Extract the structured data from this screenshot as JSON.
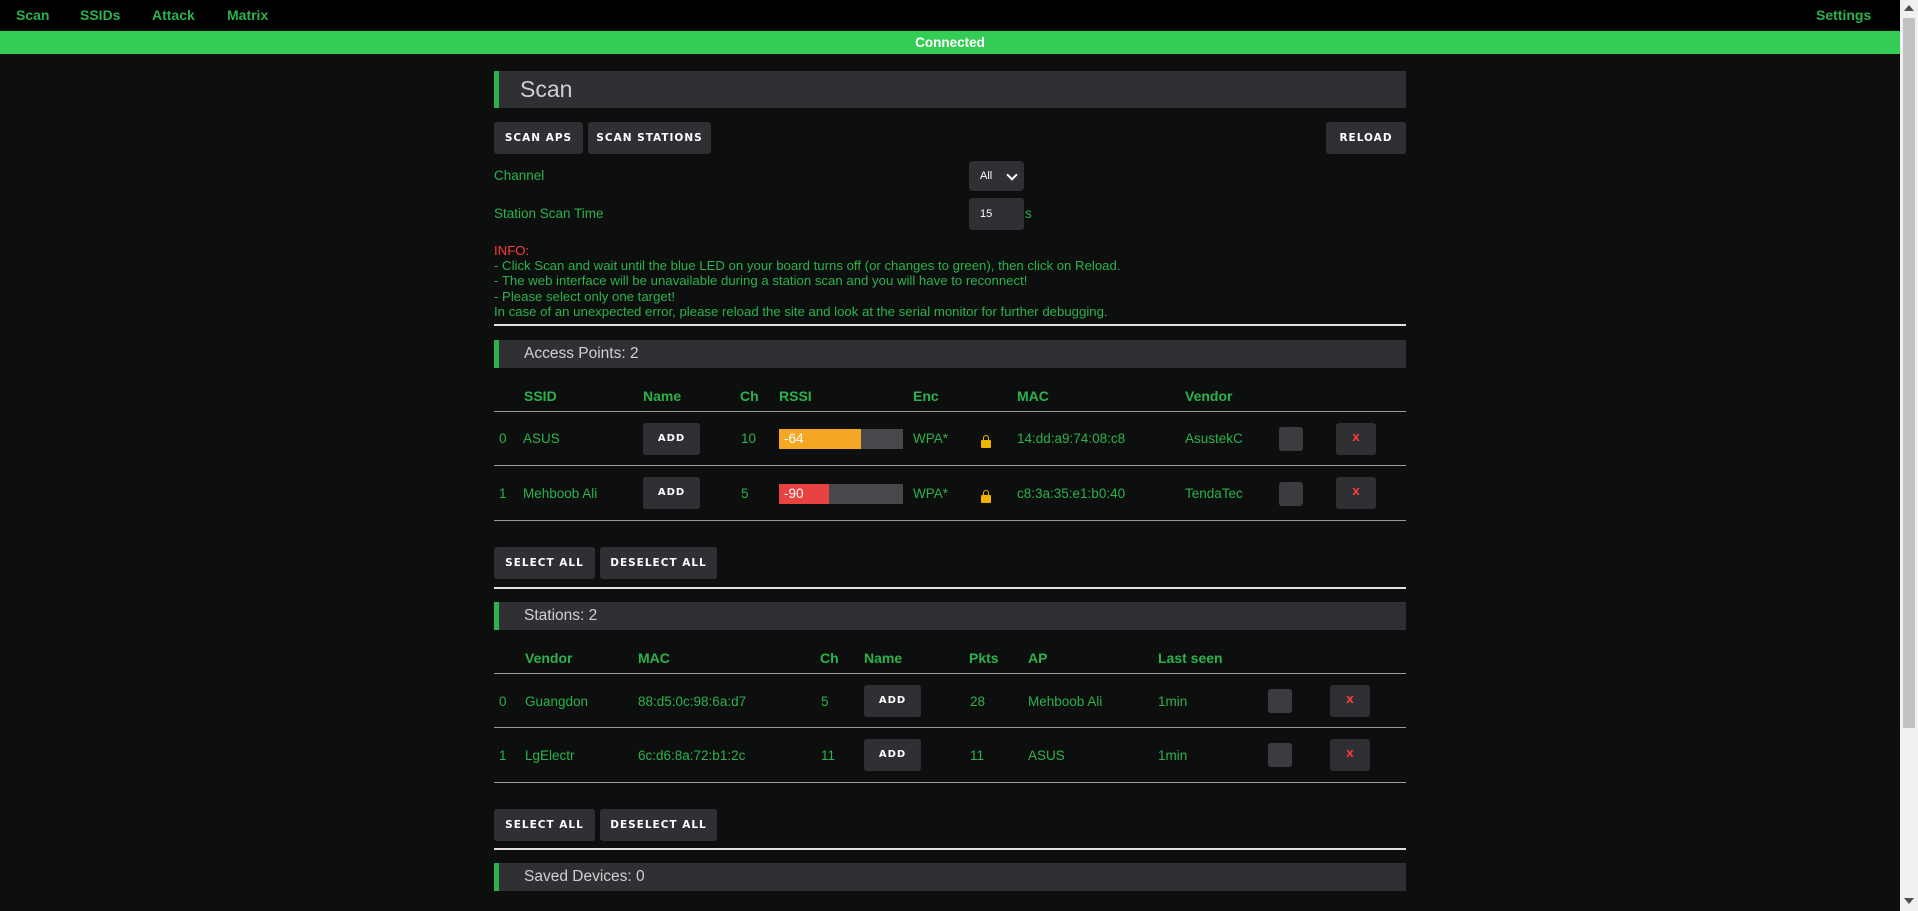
{
  "nav": {
    "items": [
      "Scan",
      "SSIDs",
      "Attack",
      "Matrix"
    ],
    "settings": "Settings"
  },
  "status": "Connected",
  "page": {
    "title": "Scan",
    "scan_aps": "SCAN APS",
    "scan_stations": "SCAN STATIONS",
    "reload": "RELOAD",
    "channel_label": "Channel",
    "channel_value": "All",
    "station_scan_time_label": "Station Scan Time",
    "station_scan_time_value": "15",
    "station_scan_time_unit": "s",
    "info": {
      "title": "INFO:",
      "lines": [
        "- Click Scan and wait until the blue LED on your board turns off (or changes to green), then click on Reload.",
        "- The web interface will be unavailable during a station scan and you will have to reconnect!",
        "- Please select only one target!",
        "In case of an unexpected error, please reload the site and look at the serial monitor for further debugging."
      ]
    }
  },
  "access_points": {
    "title": "Access Points: 2",
    "headers": {
      "ssid": "SSID",
      "name": "Name",
      "ch": "Ch",
      "rssi": "RSSI",
      "enc": "Enc",
      "mac": "MAC",
      "vendor": "Vendor"
    },
    "rows": [
      {
        "index": "0",
        "ssid": "ASUS",
        "name_btn": "ADD",
        "ch": "10",
        "rssi": "-64",
        "rssi_fraction": 0.66,
        "rssi_color": "#f5a623",
        "enc": "WPA*",
        "mac": "14:dd:a9:74:08:c8",
        "vendor": "AsustekC",
        "delete": "X"
      },
      {
        "index": "1",
        "ssid": "Mehboob Ali",
        "name_btn": "ADD",
        "ch": "5",
        "rssi": "-90",
        "rssi_fraction": 0.4,
        "rssi_color": "#e84343",
        "enc": "WPA*",
        "mac": "c8:3a:35:e1:b0:40",
        "vendor": "TendaTec",
        "delete": "X"
      }
    ],
    "select_all": "SELECT ALL",
    "deselect_all": "DESELECT ALL"
  },
  "stations": {
    "title": "Stations: 2",
    "headers": {
      "vendor": "Vendor",
      "mac": "MAC",
      "ch": "Ch",
      "name": "Name",
      "pkts": "Pkts",
      "ap": "AP",
      "last_seen": "Last seen"
    },
    "rows": [
      {
        "index": "0",
        "vendor": "Guangdon",
        "mac": "88:d5:0c:98:6a:d7",
        "ch": "5",
        "name_btn": "ADD",
        "pkts": "28",
        "ap": "Mehboob Ali",
        "last_seen": "1min",
        "delete": "X"
      },
      {
        "index": "1",
        "vendor": "LgElectr",
        "mac": "6c:d6:8a:72:b1:2c",
        "ch": "11",
        "name_btn": "ADD",
        "pkts": "11",
        "ap": "ASUS",
        "last_seen": "1min",
        "delete": "X"
      }
    ],
    "select_all": "SELECT ALL",
    "deselect_all": "DESELECT ALL"
  },
  "saved_devices": {
    "title": "Saved Devices: 0"
  },
  "colors": {
    "accent": "#2bb24c",
    "status_bar": "#33cc55",
    "danger": "#ff3b3b",
    "panel": "#2f3033",
    "background": "#0d0f0e"
  }
}
